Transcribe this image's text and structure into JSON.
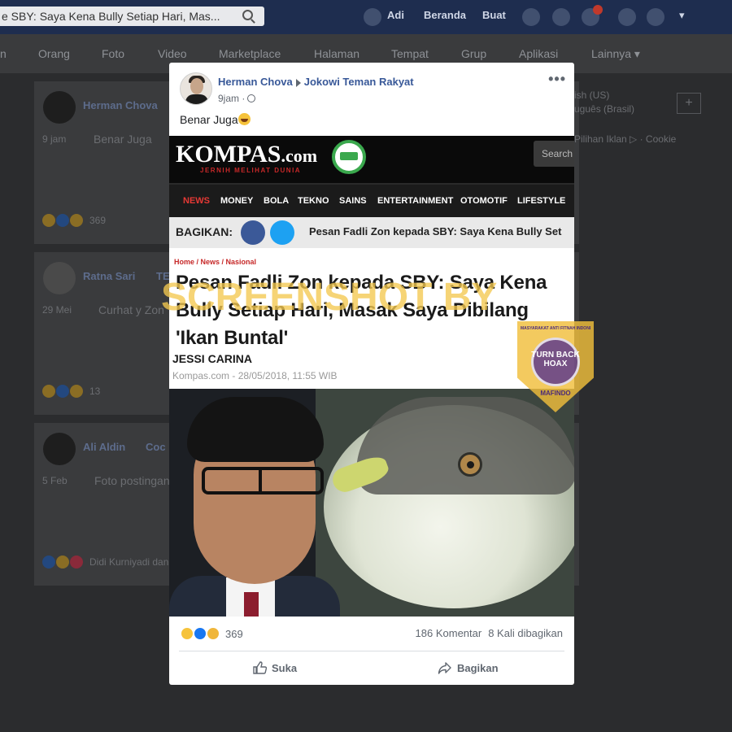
{
  "background": {
    "search_value": "e SBY: Saya Kena Bully Setiap Hari, Mas...",
    "top_user": "Adi",
    "top_home": "Beranda",
    "top_create": "Buat",
    "subnav": [
      "n",
      "Orang",
      "Foto",
      "Video",
      "Marketplace",
      "Halaman",
      "Tempat",
      "Grup",
      "Aplikasi",
      "Lainnya ▾"
    ],
    "posts": [
      {
        "name": "Herman Chova",
        "meta": "9 jam",
        "text": "Benar Juga",
        "count": "369"
      },
      {
        "name": "Ratna Sari",
        "extra": "TE",
        "meta": "29 Mei",
        "text": "Curhat y Zon",
        "count": "13"
      },
      {
        "name": "Ali Aldin",
        "extra": "Coc",
        "meta": "5 Feb",
        "text": "Foto postingan",
        "count": "Didi Kurniyadi dan"
      }
    ],
    "right": {
      "line1": "ish (US)",
      "line2": "uguês (Brasil)",
      "line3": "Pilihan Iklan ▷ · Cookie",
      "plus": "+"
    }
  },
  "post": {
    "author": "Herman Chova",
    "target": "Jokowi Teman Rakyat",
    "time": "9jam",
    "separator": "·",
    "more": "•••",
    "caption": "Benar Juga",
    "reaction_count": "369",
    "comments": "186 Komentar",
    "shares": "8 Kali dibagikan",
    "like_label": "Suka",
    "share_label": "Bagikan"
  },
  "article": {
    "logo": "KOMPAS",
    "logo_suffix": ".com",
    "tagline": "JERNIH MELIHAT DUNIA",
    "search": "Search",
    "nav": [
      "NEWS",
      "MONEY",
      "BOLA",
      "TEKNO",
      "SAINS",
      "ENTERTAINMENT",
      "OTOMOTIF",
      "LIFESTYLE"
    ],
    "share_label": "BAGIKAN:",
    "share_title": "Pesan Fadli Zon kepada SBY: Saya Kena Bully Set",
    "breadcrumb": "Home / News / Nasional",
    "headline": "Pesan Fadli Zon kepada SBY: Saya Kena Bully Setiap Hari, Masak Saya Dibilang 'Ikan Buntal'",
    "byline": "JESSI CARINA",
    "dateline": "Kompas.com - 28/05/2018, 11:55 WIB"
  },
  "watermark": {
    "text": "SCREENSHOT BY",
    "badge": "TURN BACK HOAX",
    "badge_top": "MASYARAKAT ANTI FITNAH INDONESIA",
    "badge_bottom": "MAFINDO"
  },
  "colors": {
    "accent": "#385898",
    "kompas_red": "#e53935",
    "watermark": "#f4c850"
  }
}
